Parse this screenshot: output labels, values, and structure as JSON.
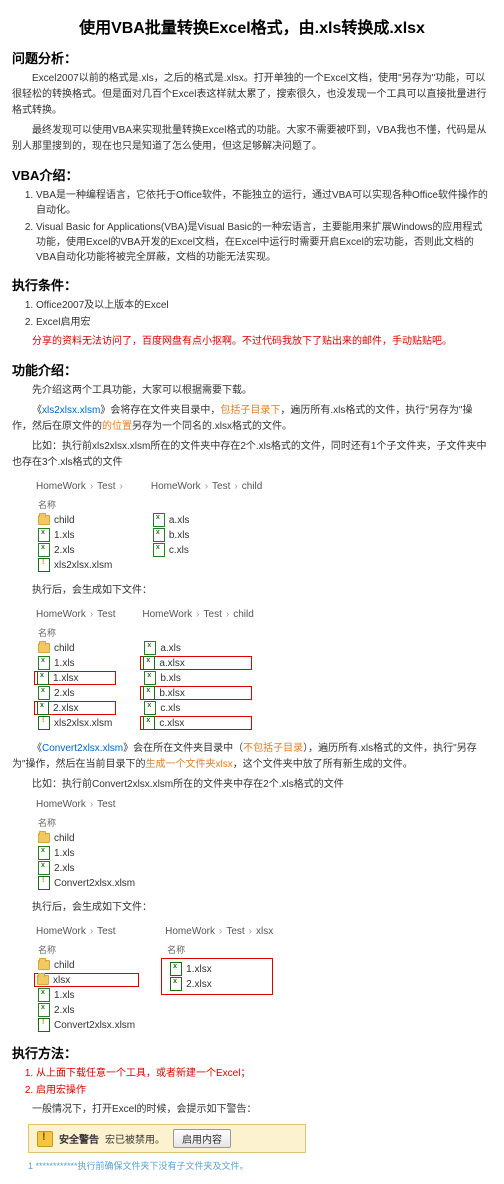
{
  "title": "使用VBA批量转换Excel格式，由.xls转换成.xlsx",
  "sections": {
    "problem": {
      "heading": "问题分析：",
      "p1": "Excel2007以前的格式是.xls，之后的格式是.xlsx。打开单独的一个Excel文档，使用\"另存为\"功能，可以很轻松的转换格式。但是面对几百个Excel表这样就太累了，搜索很久，也没发现一个工具可以直接批量进行格式转换。",
      "p2": "最终发现可以使用VBA来实现批量转换Excel格式的功能。大家不需要被吓到，VBA我也不懂，代码是从别人那里搜到的，现在也只是知道了怎么使用，但这足够解决问题了。"
    },
    "vba_intro": {
      "heading": "VBA介绍：",
      "item1": "VBA是一种编程语言，它依托于Office软件，不能独立的运行，通过VBA可以实现各种Office软件操作的自动化。",
      "item2": "Visual Basic for Applications(VBA)是Visual Basic的一种宏语言，主要能用来扩展Windows的应用程式功能，使用Excel的VBA开发的Excel文档，在Excel中运行时需要开启Excel的宏功能，否则此文档的VBA自动化功能将被完全屏蔽，文档的功能无法实现。"
    },
    "conditions": {
      "heading": "执行条件：",
      "item1": "Office2007及以上版本的Excel",
      "item2": "Excel启用宏",
      "note": "分享的资料无法访问了，百度网盘有点小抠啊。不过代码我放下了贴出来的邮件，手动贴贴吧。"
    },
    "func_intro": {
      "heading": "功能介绍：",
      "p1": "先介绍这两个工具功能，大家可以根据需要下载。",
      "p2_prefix": "《",
      "p2_link": "xls2xlsx.xlsm",
      "p2_mid": "》会将存在文件夹目录中，",
      "p2_orange": "包括子目录下",
      "p2_suffix": "，遍历所有.xls格式的文件，执行\"另存为\"操作，然后在原文件的",
      "p2_orange2": "的位置",
      "p2_end": "另存为一个同名的.xlsx格式的文件。",
      "p3": "比如：执行前xls2xlsx.xlsm所在的文件夹中存在2个.xls格式的文件，同时还有1个子文件夹，子文件夹中也存在3个.xls格式的文件"
    },
    "bc1": {
      "a": "HomeWork",
      "b": "Test",
      "c": "child"
    },
    "pane1_left": {
      "group": "名称",
      "items": [
        "child",
        "1.xls",
        "2.xls",
        "xls2xlsx.xlsm"
      ]
    },
    "pane1_right": {
      "items": [
        "a.xls",
        "b.xls",
        "c.xls"
      ]
    },
    "after1": "执行后，会生成如下文件：",
    "pane2_left": {
      "group": "名称",
      "items": [
        "child",
        "1.xls",
        "1.xlsx",
        "2.xls",
        "2.xlsx",
        "xls2xlsx.xlsm"
      ]
    },
    "pane2_right": {
      "items": [
        "a.xls",
        "a.xlsx",
        "b.xls",
        "b.xlsx",
        "c.xls",
        "c.xlsx"
      ]
    },
    "convert_p_prefix": "《",
    "convert_link": "Convert2xlsx.xlsm",
    "convert_mid": "》会在所在文件夹目录中（",
    "convert_orange": "不包括子目录",
    "convert_mid2": "），遍历所有.xls格式的文件，执行\"另存为\"操作，然后在当前目录下的",
    "convert_orange2": "生成一个文件夹xlsx",
    "convert_end": "，这个文件夹中放了所有新生成的文件。",
    "convert_p2": "比如：执行前Convert2xlsx.xlsm所在的文件夹中存在2个.xls格式的文件",
    "pane3": {
      "bc_a": "HomeWork",
      "bc_b": "Test",
      "group": "名称",
      "items": [
        "child",
        "1.xls",
        "2.xls",
        "Convert2xlsx.xlsm"
      ]
    },
    "after2": "执行后，会生成如下文件：",
    "pane4_left": {
      "bc_a": "HomeWork",
      "bc_b": "Test",
      "group": "名称",
      "items": [
        "child",
        "xlsx",
        "1.xls",
        "2.xls",
        "Convert2xlsx.xlsm"
      ]
    },
    "pane4_right": {
      "bc_a": "HomeWork",
      "bc_b": "Test",
      "bc_c": "xlsx",
      "group": "名称",
      "items": [
        "1.xlsx",
        "2.xlsx"
      ]
    },
    "method": {
      "heading": "执行方法：",
      "step1": "从上面下载任意一个工具，或者新建一个Excel；",
      "step2": "启用宏操作",
      "step2_note": "一般情况下，打开Excel的时候，会提示如下警告："
    },
    "warning": {
      "label": "安全警告",
      "text": "宏已被禁用。",
      "button": "启用内容"
    },
    "dash": "1 ************执行前确保文件夹下没有子文件夹及文件。"
  }
}
